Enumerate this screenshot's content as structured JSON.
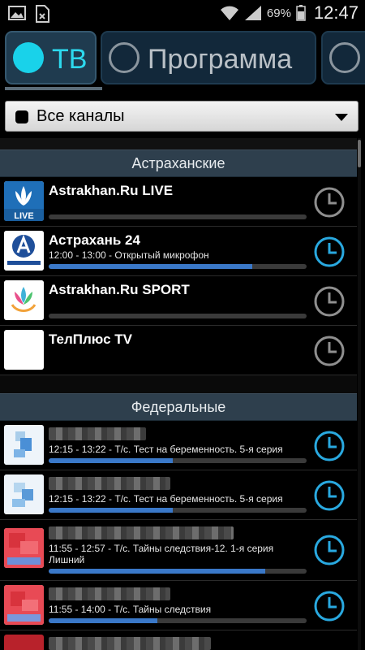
{
  "status_bar": {
    "battery_percent": "69%",
    "time": "12:47",
    "icons": [
      "image-icon",
      "sim-icon",
      "wifi-icon",
      "signal-icon",
      "battery-icon"
    ]
  },
  "tabs": [
    {
      "label": "ТВ",
      "active": true
    },
    {
      "label": "Программа",
      "active": false
    },
    {
      "label": "",
      "active": false
    }
  ],
  "filter": {
    "selected": "Все каналы"
  },
  "sections": [
    {
      "title": "Астраханские",
      "channels": [
        {
          "name": "Astrakhan.Ru LIVE",
          "program": "",
          "progress": 0,
          "alarm_active": false,
          "logo": "live-logo"
        },
        {
          "name": "Астрахань 24",
          "program": "12:00 - 13:00 - Открытый микрофон",
          "progress": 0.79,
          "alarm_active": true,
          "logo": "astrakhan24-logo"
        },
        {
          "name": "Astrakhan.Ru SPORT",
          "program": "",
          "progress": 0,
          "alarm_active": false,
          "logo": "sport-logo"
        },
        {
          "name": "ТелПлюс TV",
          "program": "",
          "progress": 0,
          "alarm_active": false,
          "logo": "blank-logo"
        }
      ]
    },
    {
      "title": "Федеральные",
      "channels": [
        {
          "name": "",
          "program": "12:15 - 13:22 - Т/с. Тест на беременность. 5-я серия",
          "progress": 0.48,
          "alarm_active": true,
          "logo": "blurred-logo"
        },
        {
          "name": "",
          "program": "12:15 - 13:22 - Т/с. Тест на беременность. 5-я серия",
          "progress": 0.48,
          "alarm_active": true,
          "logo": "blurred-logo"
        },
        {
          "name": "",
          "program": "11:55 - 12:57 - Т/с. Тайны следствия-12. 1-я серия Лишний",
          "progress": 0.84,
          "alarm_active": true,
          "logo": "blurred-red-logo"
        },
        {
          "name": "",
          "program": "11:55 - 14:00 - Т/с. Тайны следствия",
          "progress": 0.42,
          "alarm_active": true,
          "logo": "blurred-red-logo"
        }
      ]
    }
  ],
  "colors": {
    "accent": "#2dd9ee",
    "progress": "#3a78c8",
    "alarm_active": "#29a9e0",
    "alarm_inactive": "#8f8f8f"
  }
}
